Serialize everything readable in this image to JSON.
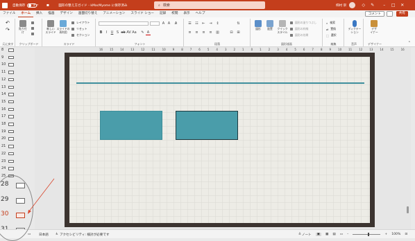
{
  "titlebar": {
    "autosave_label": "自動保存",
    "autosave_state": "オフ",
    "doc_title": "図形の整え方ガイド - kMacMyome に保存済み",
    "search_placeholder": "検索",
    "user_name": "柿村 崇",
    "icons": [
      "save-icon",
      "undo-icon",
      "redo-icon",
      "diamond-icon",
      "pen-icon",
      "minimize-icon",
      "maximize-icon",
      "close-icon"
    ]
  },
  "menu": {
    "tabs": [
      "ファイル",
      "ホーム",
      "挿入",
      "描画",
      "デザイン",
      "画面切り替え",
      "アニメーション",
      "スライド ショー",
      "記録",
      "校閲",
      "表示",
      "ヘルプ"
    ],
    "active_tab": "ホーム",
    "comment_label": "コメント",
    "share_label": "共有"
  },
  "ribbon": {
    "undo_group": "元に戻す",
    "clipboard_group": "クリップボード",
    "clipboard_paste": "貼り付け",
    "slides_group": "スライド",
    "new_slide": "新しい\nスライド",
    "reuse_slide": "スライドの\n再利用",
    "layout": "レイアウト",
    "reset": "リセット",
    "section": "セクション",
    "font_group": "フォント",
    "paragraph_group": "段落",
    "drawing_group": "図形描画",
    "drawing_shapes": "図形",
    "drawing_arrange": "配置",
    "drawing_styles": "クイック\nスタイル",
    "shape_fill": "図形の塗りつぶし",
    "shape_outline": "図形の枠線",
    "shape_effects": "図形の効果",
    "editing_group": "編集",
    "find": "検索",
    "replace": "置換",
    "select": "選択",
    "voice_group": "音声",
    "dictate": "ディクテー\nション",
    "designer_group": "デザイナー",
    "designer": "デザ\nイナー"
  },
  "slides_panel": {
    "small": [
      "8",
      "9",
      "10",
      "11",
      "12",
      "13",
      "14",
      "15",
      "16",
      "17",
      "18",
      "19",
      "20",
      "21",
      "22",
      "23",
      "24",
      "25"
    ],
    "large": [
      "28",
      "29",
      "30",
      "31"
    ],
    "selected": "30",
    "selected_color": "#c43e1c"
  },
  "ruler": {
    "ticks": [
      "16",
      "15",
      "14",
      "13",
      "12",
      "11",
      "10",
      "9",
      "8",
      "7",
      "6",
      "5",
      "4",
      "3",
      "2",
      "1",
      "0",
      "1",
      "2",
      "3",
      "4",
      "5",
      "6",
      "7",
      "8",
      "9",
      "10",
      "11",
      "12",
      "13",
      "14",
      "15",
      "16"
    ]
  },
  "slide": {
    "line_color": "#3e8e9c",
    "rect_color": "#4a9daa"
  },
  "statusbar": {
    "language": "日本語",
    "accessibility": "アクセシビリティ: 検討が必要です",
    "notes": "ノート",
    "zoom": "100%"
  }
}
